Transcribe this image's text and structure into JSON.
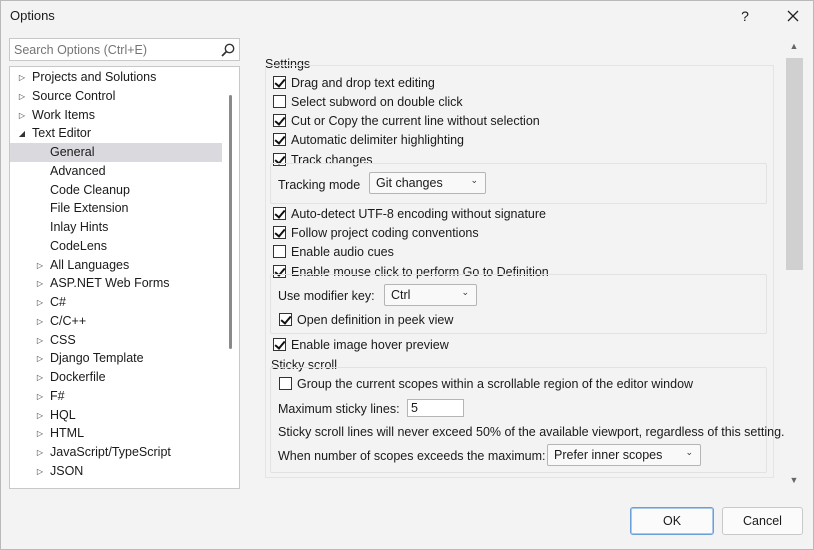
{
  "window": {
    "title": "Options",
    "help_glyph": "?"
  },
  "search": {
    "placeholder": "Search Options (Ctrl+E)"
  },
  "tree": {
    "items": [
      {
        "label": "Projects and Solutions",
        "level": 0,
        "arrow": "▷"
      },
      {
        "label": "Source Control",
        "level": 0,
        "arrow": "▷"
      },
      {
        "label": "Work Items",
        "level": 0,
        "arrow": "▷"
      },
      {
        "label": "Text Editor",
        "level": 0,
        "arrow": "◢"
      },
      {
        "label": "General",
        "level": 1,
        "arrow": "",
        "selected": true
      },
      {
        "label": "Advanced",
        "level": 1,
        "arrow": ""
      },
      {
        "label": "Code Cleanup",
        "level": 1,
        "arrow": ""
      },
      {
        "label": "File Extension",
        "level": 1,
        "arrow": ""
      },
      {
        "label": "Inlay Hints",
        "level": 1,
        "arrow": ""
      },
      {
        "label": "CodeLens",
        "level": 1,
        "arrow": ""
      },
      {
        "label": "All Languages",
        "level": 1,
        "arrow": "▷"
      },
      {
        "label": "ASP.NET Web Forms",
        "level": 1,
        "arrow": "▷"
      },
      {
        "label": "C#",
        "level": 1,
        "arrow": "▷"
      },
      {
        "label": "C/C++",
        "level": 1,
        "arrow": "▷"
      },
      {
        "label": "CSS",
        "level": 1,
        "arrow": "▷"
      },
      {
        "label": "Django Template",
        "level": 1,
        "arrow": "▷"
      },
      {
        "label": "Dockerfile",
        "level": 1,
        "arrow": "▷"
      },
      {
        "label": "F#",
        "level": 1,
        "arrow": "▷"
      },
      {
        "label": "HQL",
        "level": 1,
        "arrow": "▷"
      },
      {
        "label": "HTML",
        "level": 1,
        "arrow": "▷"
      },
      {
        "label": "JavaScript/TypeScript",
        "level": 1,
        "arrow": "▷"
      },
      {
        "label": "JSON",
        "level": 1,
        "arrow": "▷"
      }
    ]
  },
  "settings": {
    "heading": "Settings",
    "drag_drop": {
      "label": "Drag and drop text editing",
      "checked": true
    },
    "subword": {
      "label": "Select subword on double click",
      "checked": false
    },
    "cut_copy": {
      "label": "Cut or Copy the current line without selection",
      "checked": true
    },
    "delimiter": {
      "label": "Automatic delimiter highlighting",
      "checked": true
    },
    "track_changes": {
      "label": "Track changes",
      "checked": true
    },
    "tracking_mode": {
      "label": "Tracking mode",
      "value": "Git changes"
    },
    "utf8": {
      "label": "Auto-detect UTF-8 encoding without signature",
      "checked": true
    },
    "conventions": {
      "label": "Follow project coding conventions",
      "checked": true
    },
    "audio": {
      "label": "Enable audio cues",
      "checked": false
    },
    "goto_def": {
      "label": "Enable mouse click to perform Go to Definition",
      "checked": true
    },
    "modifier_key": {
      "label": "Use modifier key:",
      "value": "Ctrl"
    },
    "peek": {
      "label": "Open definition in peek view",
      "checked": true
    },
    "image_hover": {
      "label": "Enable image hover preview",
      "checked": true
    },
    "sticky": {
      "heading": "Sticky scroll",
      "group_scopes": {
        "label": "Group the current scopes within a scrollable region of the editor window",
        "checked": false
      },
      "max_lines": {
        "label": "Maximum sticky lines:",
        "value": "5"
      },
      "note": "Sticky scroll lines will never exceed 50% of the available viewport, regardless of this setting.",
      "exceeds": {
        "label": "When number of scopes exceeds the maximum:",
        "value": "Prefer inner scopes"
      }
    }
  },
  "buttons": {
    "ok": "OK",
    "cancel": "Cancel"
  },
  "scroll_glyphs": {
    "up": "▲",
    "down": "▼"
  }
}
